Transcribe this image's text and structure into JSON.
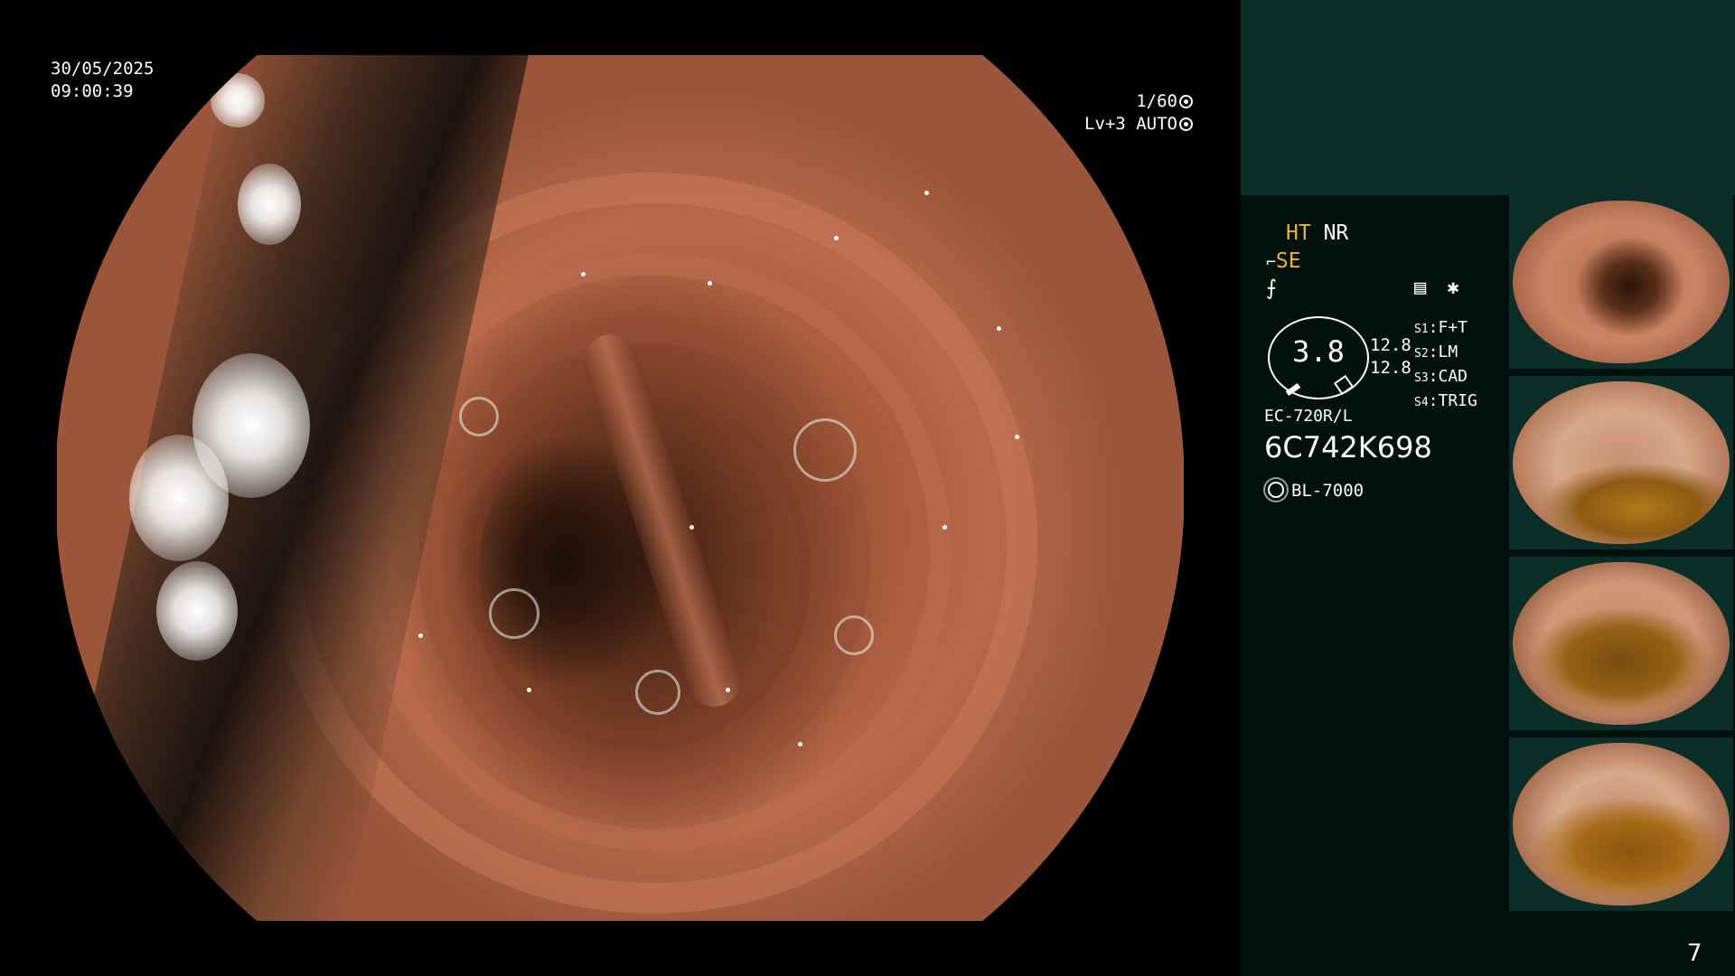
{
  "overlay": {
    "date": "30/05/2025",
    "time": "09:00:39",
    "shutter": "1/60",
    "level": "Lv+3",
    "exposure_mode": "AUTO"
  },
  "panel": {
    "ht": "HT",
    "nr": "NR",
    "se": "SE",
    "gauge_value": "3.8",
    "gauge_num_1": "12.8",
    "gauge_num_2": "12.8",
    "switches": [
      {
        "key": "S1",
        "value": "F+T"
      },
      {
        "key": "S2",
        "value": "LM"
      },
      {
        "key": "S3",
        "value": "CAD"
      },
      {
        "key": "S4",
        "value": "TRIG"
      }
    ],
    "scope_model": "EC-720R/L",
    "serial": "6C742K698",
    "light_source": "BL-7000",
    "page_number": "7"
  },
  "colors": {
    "panel_bg": "#02110d",
    "panel_top_bg": "#0b2e28",
    "accent_yellow": "#f0b323"
  },
  "icons": [
    "aperture-icon",
    "auto-exposure-icon",
    "structure-icon",
    "enhance-icon",
    "image-settings-icon",
    "asterisk-icon",
    "light-source-icon"
  ]
}
